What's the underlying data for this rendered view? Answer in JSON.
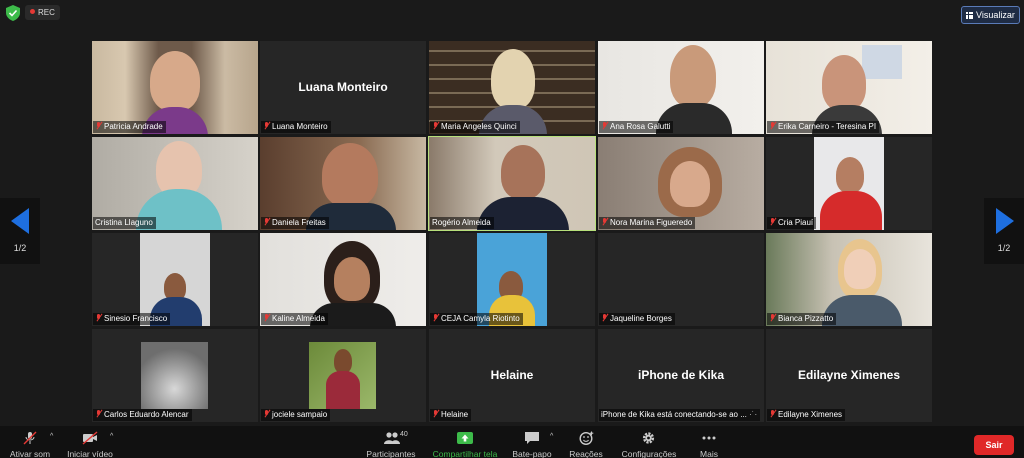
{
  "topbar": {
    "rec_label": "REC",
    "view_label": "Visualizar",
    "shield_color": "#3dbb4a"
  },
  "pager": {
    "left_label": "1/2",
    "right_label": "1/2"
  },
  "participants": [
    {
      "name": "Patricia Andrade",
      "muted": true
    },
    {
      "name": "Luana Monteiro",
      "muted": true,
      "display_name": "Luana Monteiro"
    },
    {
      "name": "Maria Angeles Quinci",
      "muted": true
    },
    {
      "name": "Ana Rosa Galutti",
      "muted": true
    },
    {
      "name": "Erika Carneiro - Teresina PI",
      "muted": true
    },
    {
      "name": "Cristina Llaguno",
      "muted": false
    },
    {
      "name": "Daniela Freitas",
      "muted": true
    },
    {
      "name": "Rogério Almeida",
      "muted": false,
      "active_speaker": true
    },
    {
      "name": "Nora Marina Figueredo",
      "muted": true
    },
    {
      "name": "Cria Piauí",
      "muted": true
    },
    {
      "name": "Sinesio Francisco",
      "muted": true
    },
    {
      "name": "Kaline Almeida",
      "muted": true
    },
    {
      "name": "CEJA Camyla Riotinto",
      "muted": true
    },
    {
      "name": "Jaqueline Borges",
      "muted": true
    },
    {
      "name": "Bianca Pizzatto",
      "muted": true
    },
    {
      "name": "Carlos Eduardo Alencar",
      "muted": true
    },
    {
      "name": "jociele sampaio",
      "muted": true
    },
    {
      "name": "Helaine",
      "muted": true,
      "display_name": "Helaine"
    },
    {
      "name": "iPhone de Kika está conectando-se ao ...",
      "muted": false,
      "display_name": "iPhone de Kika"
    },
    {
      "name": "Edilayne Ximenes",
      "muted": true,
      "display_name": "Edilayne Ximenes"
    }
  ],
  "toolbar": {
    "unmute_label": "Ativar som",
    "start_video_label": "Iniciar vídeo",
    "participants_label": "Participantes",
    "participants_count": "40",
    "share_label": "Compartilhar tela",
    "chat_label": "Bate-papo",
    "reactions_label": "Reações",
    "settings_label": "Configurações",
    "more_label": "Mais",
    "leave_label": "Sair",
    "share_color": "#3dbb4a",
    "leave_color": "#e02828"
  },
  "colors": {
    "accent": "#1e6fe0",
    "active_speaker_border": "#b7e07b",
    "muted_icon": "#e53935"
  }
}
